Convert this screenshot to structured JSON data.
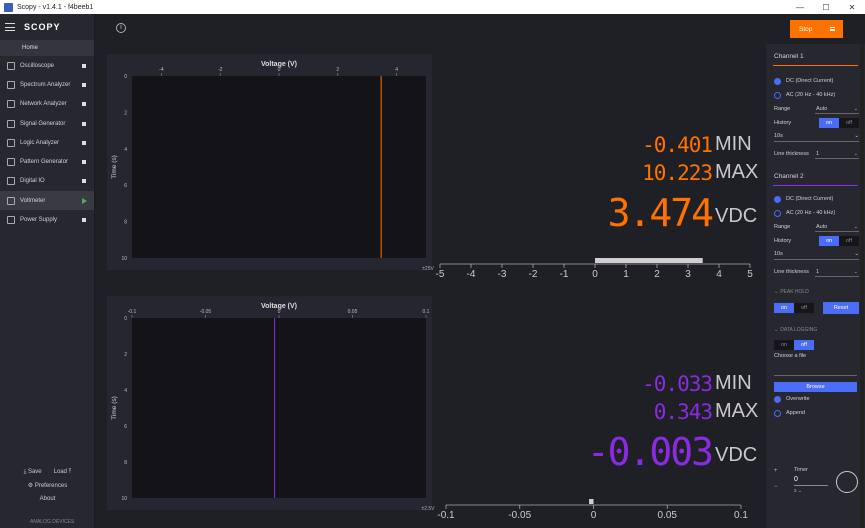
{
  "window": {
    "title": "Scopy - v1.4.1 - f4beeb1",
    "minimize": "—",
    "maximize": "☐",
    "close": "✕"
  },
  "sidebar": {
    "logo": "SCOPY",
    "home": "Home",
    "tools": [
      {
        "label": "Oscilloscope"
      },
      {
        "label": "Spectrum Analyzer"
      },
      {
        "label": "Network Analyzer"
      },
      {
        "label": "Signal Generator"
      },
      {
        "label": "Logic Analyzer"
      },
      {
        "label": "Pattern Generator"
      },
      {
        "label": "Digital IO"
      },
      {
        "label": "Voltmeter"
      },
      {
        "label": "Power Supply"
      }
    ],
    "save": "Save",
    "load": "Load",
    "preferences": "Preferences",
    "about": "About",
    "brand": "ANALOG DEVICES"
  },
  "topbar": {
    "info": "i",
    "stop_label": "Stop"
  },
  "channels": [
    {
      "color": "#ff7200",
      "min": "-0.401",
      "min_label": "MIN",
      "max": "10.223",
      "max_label": "MAX",
      "value": "3.474",
      "unit": "VDC",
      "hist_xlabel": "Voltage (V)",
      "hist_ylabel": "Time (s)",
      "hist_xticks": [
        "-4",
        "-2",
        "0",
        "2",
        "4"
      ],
      "hist_yticks": [
        "0",
        "2",
        "4",
        "6",
        "8",
        "10"
      ],
      "hist_scale": "±25V",
      "hist_xlim": [
        -5,
        5
      ],
      "bar_ticks": [
        "-5",
        "-4",
        "-3",
        "-2",
        "-1",
        "0",
        "1",
        "2",
        "3",
        "4",
        "5"
      ],
      "bar_xlim": [
        -5,
        5
      ]
    },
    {
      "color": "#8a2be2",
      "min": "-0.033",
      "min_label": "MIN",
      "max": "0.343",
      "max_label": "MAX",
      "value": "-0.003",
      "unit": "VDC",
      "hist_xlabel": "Voltage (V)",
      "hist_ylabel": "Time (s)",
      "hist_xticks": [
        "-0.1",
        "-0.05",
        "0",
        "0.05",
        "0.1"
      ],
      "hist_yticks": [
        "0",
        "2",
        "4",
        "6",
        "8",
        "10"
      ],
      "hist_scale": "±2.5V",
      "hist_xlim": [
        -0.1,
        0.1
      ],
      "bar_ticks": [
        "-0.1",
        "-0.05",
        "0",
        "0.05",
        "0.1"
      ],
      "bar_xlim": [
        -0.1,
        0.1
      ]
    }
  ],
  "panel": {
    "ch1": {
      "title": "Channel 1",
      "dc": "DC (Direct Current)",
      "ac": "AC (20 Hz - 40 kHz)",
      "range_label": "Range",
      "range_value": "Auto",
      "history_label": "History",
      "on": "on",
      "off": "off",
      "history_value": "10s",
      "thickness_label": "Line thickness",
      "thickness_value": "1"
    },
    "ch2": {
      "title": "Channel 2",
      "dc": "DC (Direct Current)",
      "ac": "AC (20 Hz - 40 kHz)",
      "range_label": "Range",
      "range_value": "Auto",
      "history_label": "History",
      "on": "on",
      "off": "off",
      "history_value": "10s",
      "thickness_label": "Line thickness",
      "thickness_value": "1"
    },
    "peak_hold": "PEAK HOLD",
    "peak_on": "on",
    "peak_off": "off",
    "reset": "Reset",
    "data_logging": "DATA LOGGING",
    "log_on": "on",
    "log_off": "off",
    "choose_file": "Choose a file",
    "browse": "Browse",
    "overwrite": "Overwrite",
    "append": "Append",
    "timer_label": "Timer",
    "timer_value": "0",
    "timer_unit": "s"
  }
}
